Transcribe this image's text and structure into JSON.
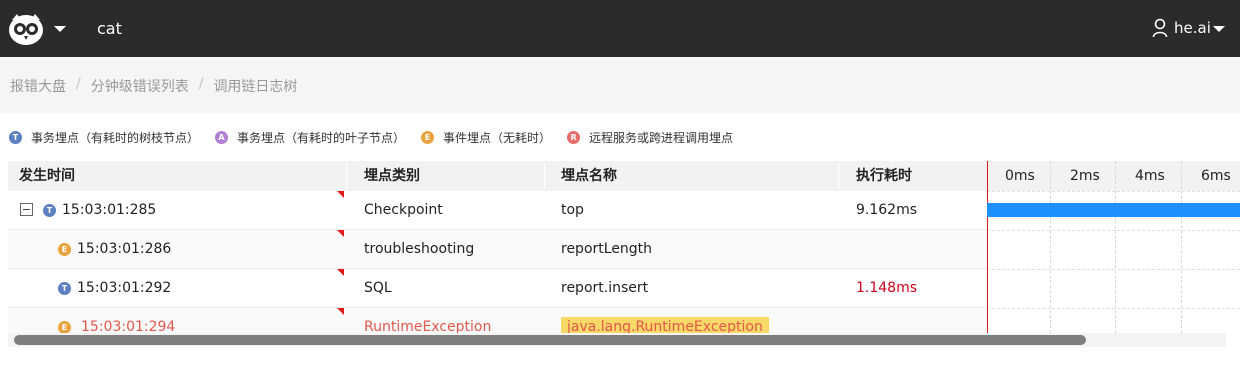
{
  "header": {
    "logo_icon": "owl-logo-icon",
    "app_name": "cat",
    "user_icon": "user-icon",
    "user_name": "he.ai"
  },
  "breadcrumb": [
    "报错大盘",
    "分钟级错误列表",
    "调用链日志树"
  ],
  "legend": [
    {
      "badge": "T",
      "label": "事务埋点（有耗时的树枝节点）",
      "color": "#5b7fc1"
    },
    {
      "badge": "A",
      "label": "事务埋点（有耗时的叶子节点）",
      "color": "#b07fd6"
    },
    {
      "badge": "E",
      "label": "事件埋点（无耗时）",
      "color": "#e8a33d"
    },
    {
      "badge": "R",
      "label": "远程服务或跨进程调用埋点",
      "color": "#e86b6b"
    }
  ],
  "table": {
    "columns": [
      "发生时间",
      "埋点类别",
      "埋点名称",
      "执行耗时"
    ],
    "rows": [
      {
        "badge": "T",
        "time": "15:03:01:285",
        "type": "Checkpoint",
        "name": "top",
        "duration": "9.162ms",
        "expandable": true
      },
      {
        "badge": "E",
        "time": "15:03:01:286",
        "type": "troubleshooting",
        "name": "reportLength",
        "duration": ""
      },
      {
        "badge": "T",
        "time": "15:03:01:292",
        "type": "SQL",
        "name": "report.insert",
        "duration": "1.148ms"
      },
      {
        "badge": "E",
        "time": "15:03:01:294",
        "type": "RuntimeException",
        "name": "java.lang.RuntimeException",
        "duration": "",
        "error": true
      }
    ]
  },
  "timeline": {
    "ticks": [
      "0ms",
      "2ms",
      "4ms",
      "6ms"
    ],
    "bar_color": "#1e90ff"
  }
}
